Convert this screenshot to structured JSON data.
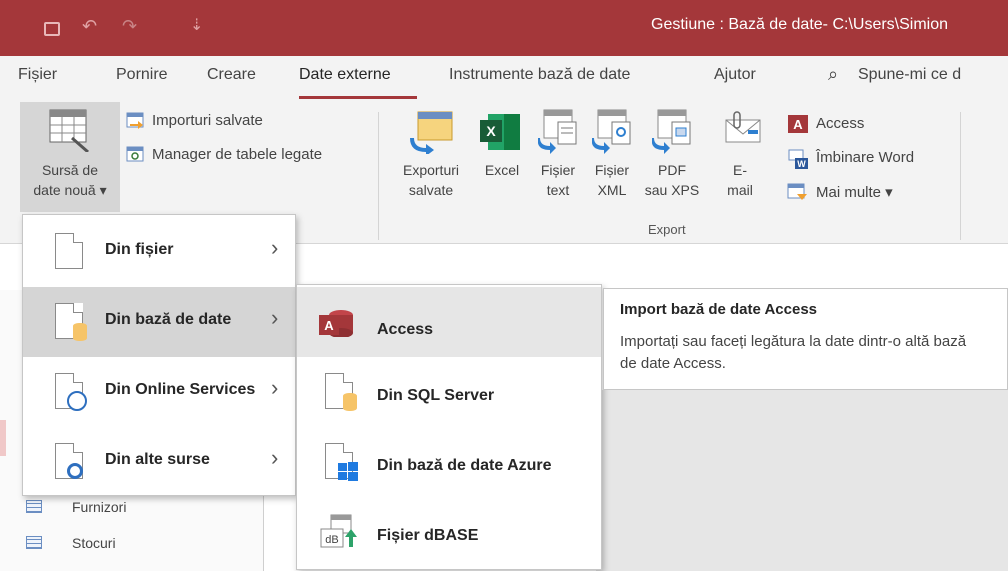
{
  "titlebar": {
    "title": "Gestiune : Bază de date- C:\\Users\\Simion"
  },
  "tabs": [
    {
      "label": "Fișier"
    },
    {
      "label": "Pornire"
    },
    {
      "label": "Creare"
    },
    {
      "label": "Date externe",
      "active": true
    },
    {
      "label": "Instrumente bază de date"
    },
    {
      "label": "Ajutor"
    }
  ],
  "tell_me": "Spune-mi ce d",
  "ribbon": {
    "new_source_line1": "Sursă de",
    "new_source_line2": "date nouă ▾",
    "saved_imports": "Importuri salvate",
    "linked_table_manager": "Manager de tabele legate",
    "export": {
      "saved_exports_line1": "Exporturi",
      "saved_exports_line2": "salvate",
      "excel": "Excel",
      "text_file_line1": "Fișier",
      "text_file_line2": "text",
      "xml_file_line1": "Fișier",
      "xml_file_line2": "XML",
      "pdf_line1": "PDF",
      "pdf_line2": "sau XPS",
      "email_line1": "E-",
      "email_line2": "mail",
      "access": "Access",
      "word_merge": "Îmbinare Word",
      "more": "Mai multe ▾",
      "group_label": "Export"
    }
  },
  "menu_sources": {
    "items": [
      {
        "label": "Din fișier"
      },
      {
        "label": "Din bază de date"
      },
      {
        "label": "Din Online Services"
      },
      {
        "label": "Din alte surse"
      }
    ]
  },
  "menu_databases": {
    "items": [
      {
        "label": "Access"
      },
      {
        "label": "Din SQL Server"
      },
      {
        "label": "Din bază de date Azure"
      },
      {
        "label": "Fișier dBASE"
      }
    ]
  },
  "tooltip": {
    "title": "Import bază de date Access",
    "body": "Importați sau faceți legătura la date dintr-o altă bază de date Access."
  },
  "nav_pane": {
    "items": [
      {
        "label": "Furnizori"
      },
      {
        "label": "Stocuri"
      }
    ]
  },
  "colors": {
    "accent": "#a4373a",
    "ribbon_bg": "#f3f3f3",
    "menu_selected": "#d5d5d5",
    "excel_green": "#1e7145",
    "access_red": "#a4373a"
  }
}
